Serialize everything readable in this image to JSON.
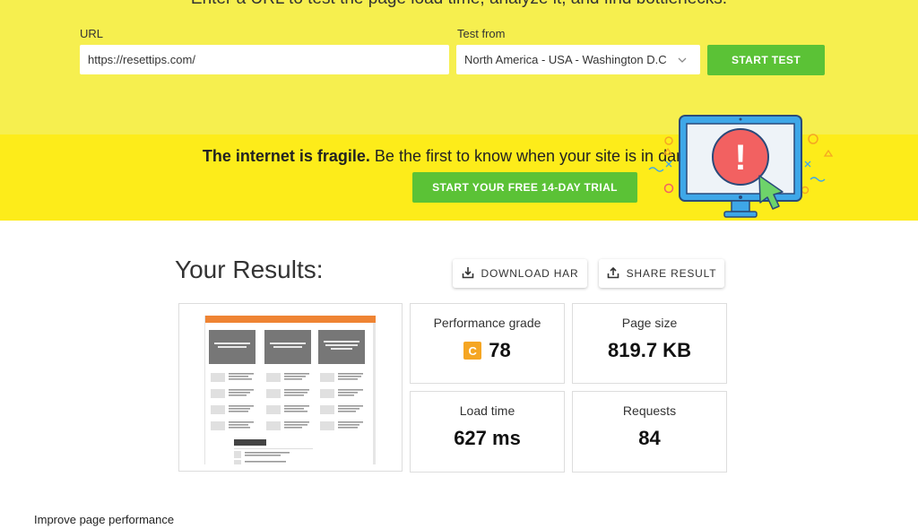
{
  "test_form": {
    "intro_text": "Enter a URL to test the page load time, analyze it, and find bottlenecks.",
    "url_label": "URL",
    "url_value": "https://resettips.com/",
    "test_from_label": "Test from",
    "test_from_value": "North America - USA - Washington D.C",
    "start_test_label": "START TEST"
  },
  "promo": {
    "headline_bold": "The internet is fragile.",
    "headline_rest": "Be the first to know when your site is in danger.",
    "trial_button_label": "START YOUR FREE 14-DAY TRIAL",
    "alert_glyph": "!"
  },
  "results": {
    "title": "Your Results:",
    "download_har_label": "DOWNLOAD HAR",
    "share_result_label": "SHARE RESULT",
    "performance_grade_label": "Performance grade",
    "performance_grade_letter": "C",
    "performance_grade_value": "78",
    "page_size_label": "Page size",
    "page_size_value": "819.7 KB",
    "load_time_label": "Load time",
    "load_time_value": "627 ms",
    "requests_label": "Requests",
    "requests_value": "84"
  },
  "improve_heading": "Improve page performance",
  "colors": {
    "top_yellow": "#f6ef4f",
    "promo_yellow": "#fdec1a",
    "green_button": "#5bc236",
    "grade_orange": "#f5a623",
    "thumb_header_orange": "#ef8433",
    "alert_red": "#f26161",
    "monitor_blue": "#3ea7e8"
  },
  "icons": {
    "download": "download-icon",
    "share": "share-icon",
    "chevron": "chevron-down-icon",
    "monitor": "monitor-alert-illustration",
    "cursor": "cursor-arrow-icon"
  }
}
